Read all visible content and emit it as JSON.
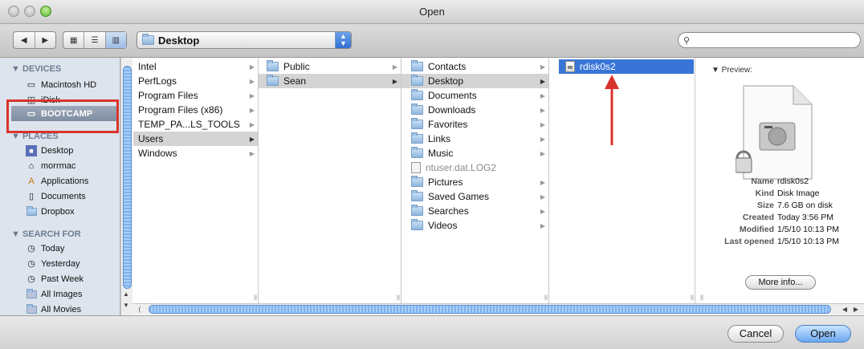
{
  "window": {
    "title": "Open"
  },
  "toolbar": {
    "location": "Desktop",
    "search_placeholder": ""
  },
  "sidebar": {
    "devices_header": "▼ DEVICES",
    "devices": [
      "Macintosh HD",
      "iDisk",
      "BOOTCAMP"
    ],
    "places_header": "▼ PLACES",
    "places": [
      "Desktop",
      "morrmac",
      "Applications",
      "Documents",
      "Dropbox"
    ],
    "search_header": "▼ SEARCH FOR",
    "search": [
      "Today",
      "Yesterday",
      "Past Week",
      "All Images",
      "All Movies"
    ]
  },
  "columns": {
    "col1": [
      "Intel",
      "PerfLogs",
      "Program Files",
      "Program Files (x86)",
      "TEMP_PA...LS_TOOLS",
      "Users",
      "Windows"
    ],
    "col2": [
      "Public",
      "Sean"
    ],
    "col3": [
      "Contacts",
      "Desktop",
      "Documents",
      "Downloads",
      "Favorites",
      "Links",
      "Music",
      "ntuser.dat.LOG2",
      "Pictures",
      "Saved Games",
      "Searches",
      "Videos"
    ],
    "col4": [
      "rdisk0s2"
    ]
  },
  "preview": {
    "header": "▼ Preview:",
    "rows": [
      {
        "k": "Name",
        "v": "rdisk0s2"
      },
      {
        "k": "Kind",
        "v": "Disk Image"
      },
      {
        "k": "Size",
        "v": "7.6 GB on disk"
      },
      {
        "k": "Created",
        "v": "Today 3:56 PM"
      },
      {
        "k": "Modified",
        "v": "1/5/10 10:13 PM"
      },
      {
        "k": "Last opened",
        "v": "1/5/10 10:13 PM"
      }
    ],
    "more_info": "More info..."
  },
  "buttons": {
    "cancel": "Cancel",
    "open": "Open"
  },
  "colors": {
    "selection_blue": "#3875d7",
    "annotation_red": "#d9342b"
  }
}
